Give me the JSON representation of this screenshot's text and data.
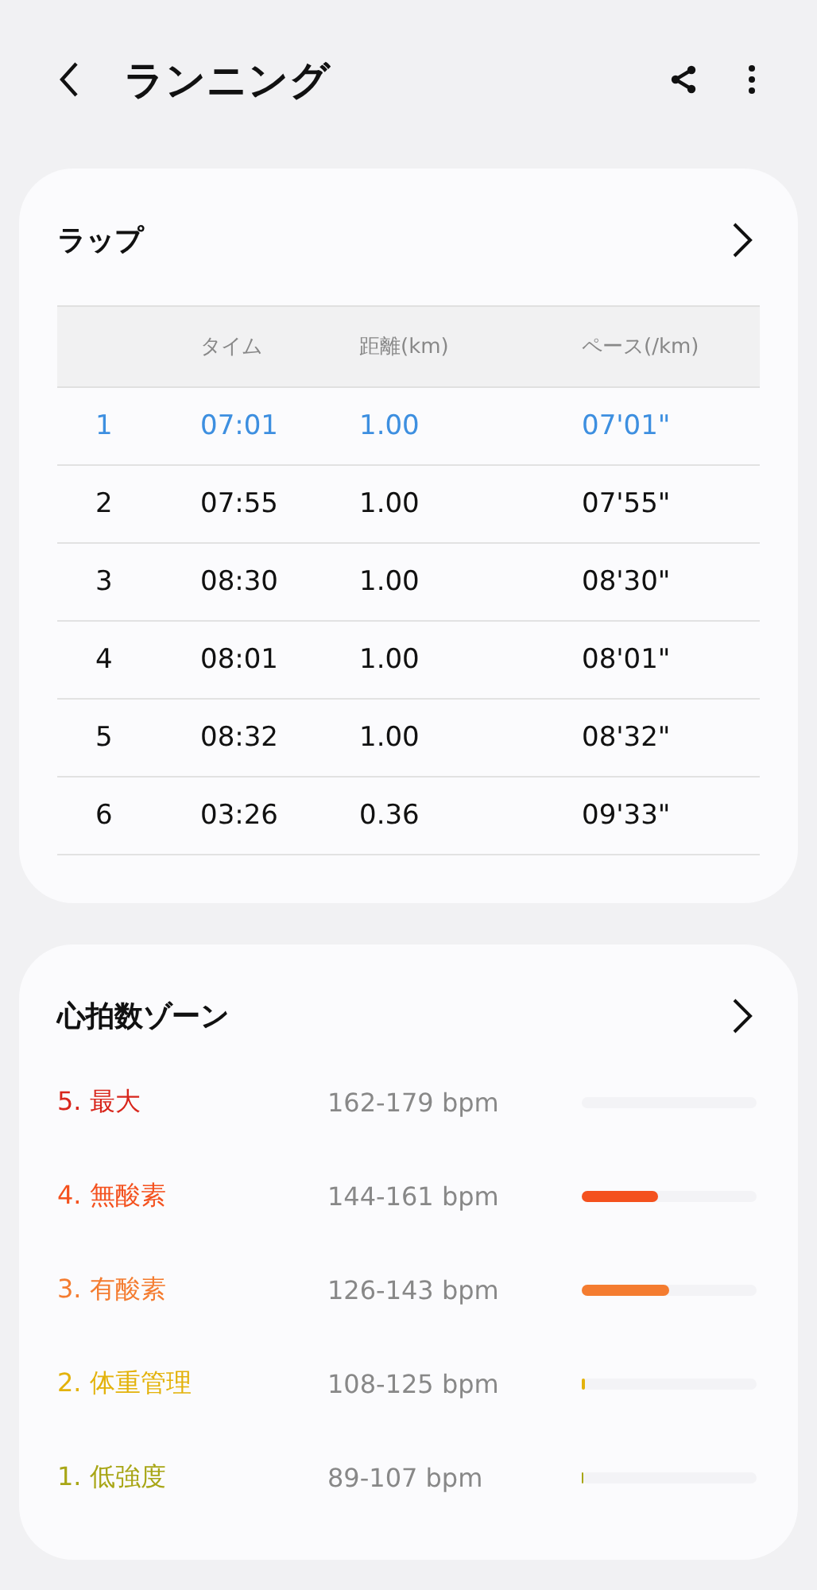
{
  "app_bar": {
    "title": "ランニング"
  },
  "laps": {
    "title": "ラップ",
    "columns": [
      "タイム",
      "距離(km)",
      "ペース(/km)"
    ],
    "rows": [
      {
        "lap": "1",
        "time": "07:01",
        "distance": "1.00",
        "pace": "07'01\"",
        "selected": true
      },
      {
        "lap": "2",
        "time": "07:55",
        "distance": "1.00",
        "pace": "07'55\"",
        "selected": false
      },
      {
        "lap": "3",
        "time": "08:30",
        "distance": "1.00",
        "pace": "08'30\"",
        "selected": false
      },
      {
        "lap": "4",
        "time": "08:01",
        "distance": "1.00",
        "pace": "08'01\"",
        "selected": false
      },
      {
        "lap": "5",
        "time": "08:32",
        "distance": "1.00",
        "pace": "08'32\"",
        "selected": false
      },
      {
        "lap": "6",
        "time": "03:26",
        "distance": "0.36",
        "pace": "09'33\"",
        "selected": false
      }
    ]
  },
  "heart_rate_zones": {
    "title": "心拍数ゾーン",
    "zones": [
      {
        "name": "5. 最大",
        "range": "162-179 bpm",
        "color": "#d8261c"
      },
      {
        "name": "4. 無酸素",
        "range": "144-161 bpm",
        "color": "#f4511e",
        "level": 0.44
      },
      {
        "name": "3. 有酸素",
        "range": "126-143 bpm",
        "color": "#f47c30",
        "level": 0.5
      },
      {
        "name": "2. 体重管理",
        "range": "108-125 bpm",
        "color": "#e3b20a",
        "level": 0.02
      },
      {
        "name": "1. 低強度",
        "range": "89-107 bpm",
        "color": "#a8a616",
        "level": 0.01
      }
    ]
  }
}
